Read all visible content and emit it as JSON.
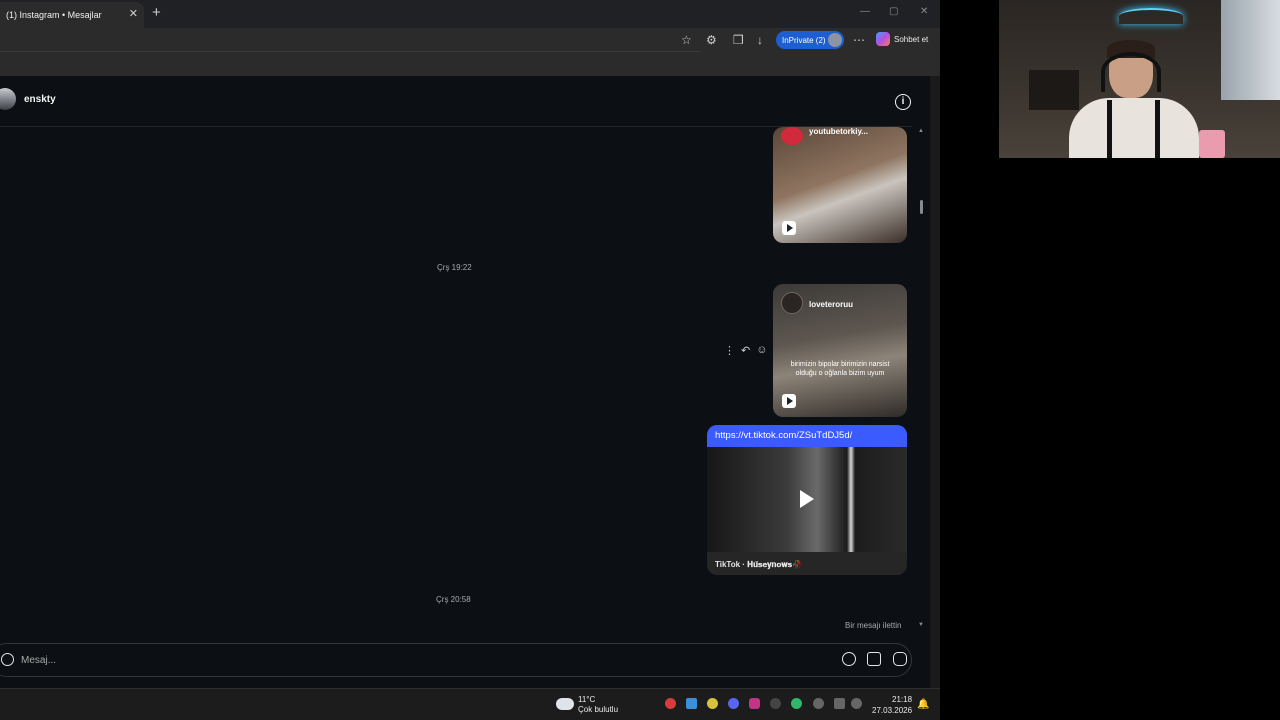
{
  "browser": {
    "tab_title": "(1) Instagram • Mesajlar",
    "tab_close": "✕",
    "new_tab": "+",
    "inprivate_label": "InPrivate (2)",
    "copilot_label": "Sohbet et",
    "min_glyph": "—",
    "max_glyph": "▢",
    "close_glyph": "✕",
    "toolbar_icons": [
      "star-icon",
      "extensions-icon",
      "collections-icon",
      "download-icon",
      "more-icon"
    ]
  },
  "conversation": {
    "username": "enskty",
    "info_glyph": "i",
    "messages": {
      "reel1_handle": "youtubetorkiy...",
      "timestamp1": "Çrş 19:22",
      "reel2_handle": "loveteroruu",
      "reel2_caption": "birimizin bipolar birimizin narsist olduğu o oğlanla bizim uyum",
      "tiktok_url": "https://vt.tiktok.com/ZSuTdDJ5d/",
      "tiktok_source": "TikTok · 𝐇𝐮̈𝐬𝐞𝐲𝐧𝐨𝐰𝐬🥀",
      "timestamp2": "Çrş 20:58",
      "forwarded_note": "Bir mesajı ilettin"
    },
    "actions": {
      "more": "⋮",
      "reply": "↶",
      "react": "☺"
    },
    "composer": {
      "placeholder": "Mesaj..."
    }
  },
  "taskbar": {
    "weather_temp": "11°C",
    "weather_desc": "Çok bulutlu",
    "time": "21:18",
    "date": "27.03.2026",
    "bell_glyph": "🔔"
  },
  "colors": {
    "accent_blue": "#3b5bff",
    "inprivate_blue": "#1d5fd1",
    "ig_background": "#0c1014"
  }
}
